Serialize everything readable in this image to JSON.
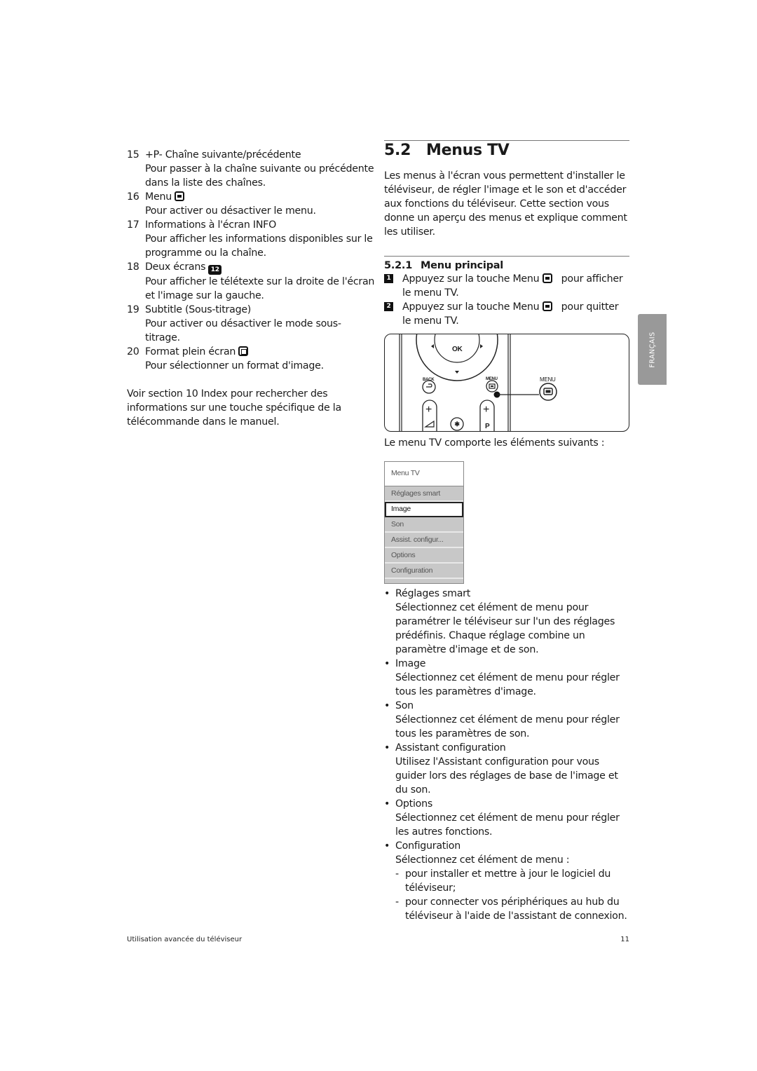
{
  "left_column": {
    "items": [
      {
        "num": "15",
        "title": "+P-  Chaîne suivante/précédente",
        "icon": null,
        "desc": "Pour passer à la chaîne suivante ou précédente dans la liste des chaînes."
      },
      {
        "num": "16",
        "title": "Menu",
        "icon": "menu-key-icon",
        "desc": "Pour activer ou désactiver le menu."
      },
      {
        "num": "17",
        "title": "Informations à l'écran INFO",
        "icon": null,
        "desc": "Pour afficher les informations disponibles sur le programme ou la chaîne."
      },
      {
        "num": "18",
        "title": "Deux écrans",
        "icon": "dual-screen-key-icon",
        "icon_text": "12",
        "desc": "Pour afficher le télétexte sur la droite de l'écran et l'image sur la gauche."
      },
      {
        "num": "19",
        "title": "Subtitle (Sous-titrage)",
        "icon": null,
        "desc": "Pour activer ou désactiver le mode sous-titrage."
      },
      {
        "num": "20",
        "title": "Format plein écran",
        "icon": "fullscreen-format-key-icon",
        "desc": "Pour sélectionner un format d'image."
      }
    ],
    "see_also": {
      "before": "Voir section ",
      "ref": "10 Index",
      "after": " pour rechercher des informations sur une touche spécifique de la télécommande dans le manuel."
    }
  },
  "right_column": {
    "section": {
      "number": "5.2",
      "title": "Menus TV"
    },
    "intro": "Les menus à l'écran vous permettent d'installer le téléviseur, de régler l'image et le son et d'accéder aux fonctions du téléviseur. Cette section vous donne un aperçu des menus et explique comment les utiliser.",
    "subsection": {
      "number": "5.2.1",
      "title": "Menu principal"
    },
    "steps": [
      {
        "n": "1",
        "before": "Appuyez sur la touche ",
        "key": "Menu",
        "after": " pour afficher le menu TV."
      },
      {
        "n": "2",
        "before": "Appuyez sur la touche ",
        "key": "Menu",
        "after": " pour quitter le menu TV."
      }
    ],
    "remote": {
      "ok": "OK",
      "back": "BACK",
      "menu_small": "MENU",
      "menu_large": "MENU",
      "plus": "+",
      "p": "P"
    },
    "menu_intro": {
      "before": "Le ",
      "key": "menu TV",
      "after": " comporte les éléments suivants :"
    },
    "tv_menu": {
      "header": "Menu TV",
      "items": [
        "Réglages smart",
        "Image",
        "Son",
        "Assist. configur...",
        "Options",
        "Configuration"
      ],
      "selected": "Image"
    },
    "descriptions": [
      {
        "title": "Réglages smart",
        "text": "Sélectionnez cet élément de menu pour paramétrer le téléviseur sur l'un des réglages prédéfinis. Chaque réglage combine un paramètre d'image et de son."
      },
      {
        "title": "Image",
        "text": "Sélectionnez cet élément de menu pour régler tous les paramètres d'image."
      },
      {
        "title": "Son",
        "text": "Sélectionnez cet élément de menu pour régler tous les paramètres de son."
      },
      {
        "title": "Assistant configuration",
        "text": "Utilisez l'Assistant configuration pour vous guider lors des réglages de base de l'image et du son."
      },
      {
        "title": "Options",
        "text": "Sélectionnez cet élément de menu pour régler les autres fonctions."
      },
      {
        "title": "Configuration",
        "text": "Sélectionnez cet élément de menu :",
        "sub": [
          "pour installer et mettre à jour le logiciel du téléviseur;",
          "pour connecter vos périphériques au hub du téléviseur à l'aide de l'assistant de connexion."
        ]
      }
    ]
  },
  "side_tab": "FRANÇAIS",
  "footer": {
    "chapter": "Utilisation avancée du téléviseur",
    "page": "11"
  }
}
